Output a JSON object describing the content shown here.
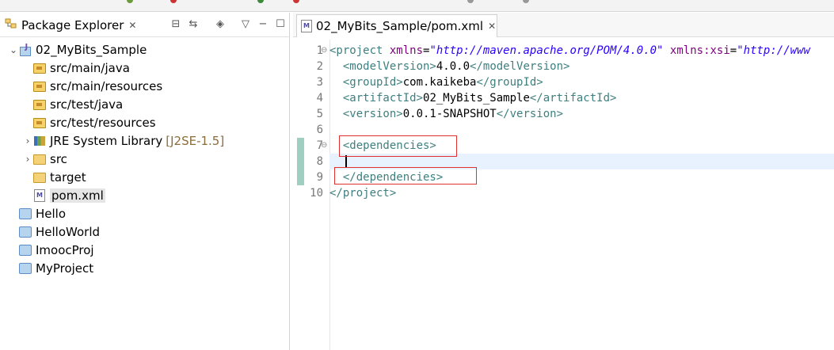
{
  "explorer": {
    "tab_label": "Package Explorer",
    "tree": [
      {
        "label": "02_MyBits_Sample",
        "icon": "maven-project-icon",
        "expanded": true
      },
      {
        "label": "src/main/java",
        "icon": "package-folder-icon"
      },
      {
        "label": "src/main/resources",
        "icon": "package-folder-icon"
      },
      {
        "label": "src/test/java",
        "icon": "package-folder-icon"
      },
      {
        "label": "src/test/resources",
        "icon": "package-folder-icon"
      },
      {
        "label": "JRE System Library",
        "decoration": "[J2SE-1.5]",
        "icon": "library-icon"
      },
      {
        "label": "src",
        "icon": "folder-icon"
      },
      {
        "label": "target",
        "icon": "folder-icon"
      },
      {
        "label": "pom.xml",
        "icon": "xml-file-icon",
        "selected": true
      },
      {
        "label": "Hello",
        "icon": "project-icon"
      },
      {
        "label": "HelloWorld",
        "icon": "project-icon"
      },
      {
        "label": "ImoocProj",
        "icon": "project-icon"
      },
      {
        "label": "MyProject",
        "icon": "project-icon"
      }
    ]
  },
  "editor": {
    "tab_label": "02_MyBits_Sample/pom.xml",
    "lines": [
      {
        "num": "1",
        "html": "<span class='tag'>&lt;project</span> <span class='attr'>xmlns</span>=<span class='val'>\"http://maven.apache.org/POM/4.0.0\"</span> <span class='attr'>xmlns:xsi</span>=<span class='val'>\"http://www</span>"
      },
      {
        "num": "2",
        "html": "  <span class='tag'>&lt;modelVersion&gt;</span><span class='txt'>4.0.0</span><span class='tag'>&lt;/modelVersion&gt;</span>"
      },
      {
        "num": "3",
        "html": "  <span class='tag'>&lt;groupId&gt;</span><span class='txt'>com.kaikeba</span><span class='tag'>&lt;/groupId&gt;</span>"
      },
      {
        "num": "4",
        "html": "  <span class='tag'>&lt;artifactId&gt;</span><span class='txt'>02_MyBits_Sample</span><span class='tag'>&lt;/artifactId&gt;</span>"
      },
      {
        "num": "5",
        "html": "  <span class='tag'>&lt;version&gt;</span><span class='txt'>0.0.1-SNAPSHOT</span><span class='tag'>&lt;/version&gt;</span>"
      },
      {
        "num": "6",
        "html": ""
      },
      {
        "num": "7",
        "html": "  <span class='tag'>&lt;dependencies&gt;</span>"
      },
      {
        "num": "8",
        "html": ""
      },
      {
        "num": "9",
        "html": "  <span class='tag'>&lt;/dependencies&gt;</span>"
      },
      {
        "num": "10",
        "html": "<span class='tag'>&lt;/project&gt;</span>"
      }
    ]
  },
  "colors": {
    "tag": "#3f7f7f",
    "attr": "#7f007f",
    "value": "#2a00ff",
    "highlight": "#e03030"
  }
}
